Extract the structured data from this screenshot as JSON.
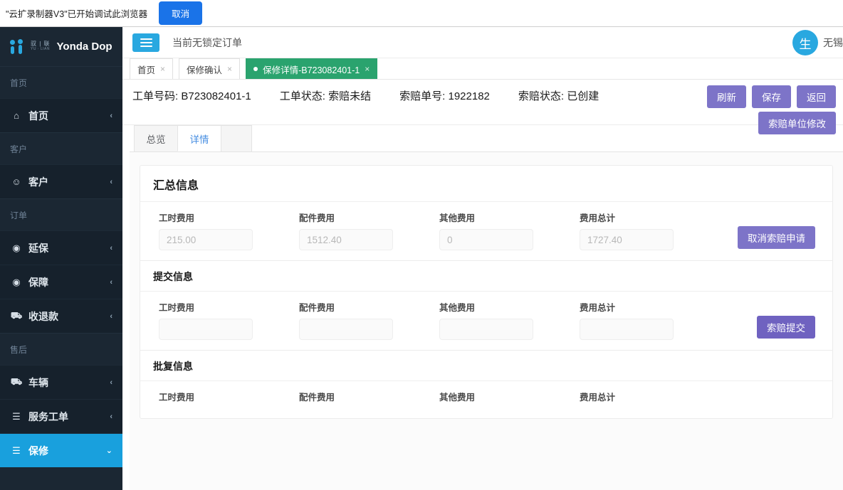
{
  "debug_bar": {
    "message": "\"云扩录制器V3\"已开始调试此浏览器",
    "cancel_label": "取消"
  },
  "sidebar": {
    "brand": {
      "logo_cn_top": "驭 | 联",
      "logo_cn_sub": "YU · LIAN",
      "name": "Yonda Dop"
    },
    "groups": [
      {
        "header": "首页",
        "items": [
          {
            "icon": "home-icon",
            "glyph": "⌂",
            "label": "首页",
            "arrow": "‹",
            "active": false
          }
        ]
      },
      {
        "header": "客户",
        "items": [
          {
            "icon": "user-icon",
            "glyph": "☺",
            "label": "客户",
            "arrow": "‹",
            "active": false
          }
        ]
      },
      {
        "header": "订单",
        "items": [
          {
            "icon": "shield-icon",
            "glyph": "◉",
            "label": "延保",
            "arrow": "‹",
            "active": false
          },
          {
            "icon": "shield-icon",
            "glyph": "◉",
            "label": "保障",
            "arrow": "‹",
            "active": false
          },
          {
            "icon": "car-icon",
            "glyph": "⛟",
            "label": "收退款",
            "arrow": "‹",
            "active": false
          }
        ]
      },
      {
        "header": "售后",
        "items": [
          {
            "icon": "car-icon",
            "glyph": "⛟",
            "label": "车辆",
            "arrow": "‹",
            "active": false
          },
          {
            "icon": "clipboard-icon",
            "glyph": "☰",
            "label": "服务工单",
            "arrow": "‹",
            "active": false
          },
          {
            "icon": "clipboard-icon",
            "glyph": "☰",
            "label": "保修",
            "arrow": "⌄",
            "active": true
          }
        ]
      }
    ]
  },
  "topbar": {
    "menu_toggle": "hamburger-icon",
    "lock_status": "当前无锁定订单",
    "avatar_initial": "生",
    "user_name": "无锡"
  },
  "doc_tabs": [
    {
      "label": "首页",
      "close": "×",
      "active": false
    },
    {
      "label": "保修确认",
      "close": "×",
      "active": false
    },
    {
      "label": "保修详情-B723082401-1",
      "close": "×",
      "active": true
    }
  ],
  "infobar": {
    "fields": [
      {
        "label": "工单号码:",
        "value": "B723082401-1"
      },
      {
        "label": "工单状态:",
        "value": "索赔未结"
      },
      {
        "label": "索赔单号:",
        "value": "1922182"
      },
      {
        "label": "索赔状态:",
        "value": "已创建"
      }
    ],
    "buttons_row1": [
      {
        "label": "刷新",
        "style": "muted"
      },
      {
        "label": "保存",
        "style": "muted"
      },
      {
        "label": "返回",
        "style": "muted"
      }
    ],
    "buttons_row2": [
      {
        "label": "索赔单位修改",
        "style": "muted"
      }
    ]
  },
  "sub_tabs": [
    {
      "label": "总览",
      "active": false
    },
    {
      "label": "详情",
      "active": true
    }
  ],
  "main": {
    "summary_panel": {
      "title": "汇总信息",
      "fields": [
        {
          "label": "工时费用",
          "value": "215.00",
          "placeholder": ""
        },
        {
          "label": "配件费用",
          "value": "1512.40",
          "placeholder": ""
        },
        {
          "label": "其他费用",
          "value": "0",
          "placeholder": ""
        },
        {
          "label": "费用总计",
          "value": "1727.40",
          "placeholder": ""
        }
      ],
      "action": {
        "label": "取消索赔申请",
        "style": "muted"
      }
    },
    "submit_panel": {
      "title": "提交信息",
      "fields": [
        {
          "label": "工时费用",
          "value": "",
          "placeholder": ""
        },
        {
          "label": "配件费用",
          "value": "",
          "placeholder": ""
        },
        {
          "label": "其他费用",
          "value": "",
          "placeholder": ""
        },
        {
          "label": "费用总计",
          "value": "",
          "placeholder": ""
        }
      ],
      "action": {
        "label": "索赔提交",
        "style": "solid"
      }
    },
    "approval_panel": {
      "title": "批复信息",
      "fields": [
        {
          "label": "工时费用",
          "value": "",
          "placeholder": ""
        },
        {
          "label": "配件费用",
          "value": "",
          "placeholder": ""
        },
        {
          "label": "其他费用",
          "value": "",
          "placeholder": ""
        },
        {
          "label": "费用总计",
          "value": "",
          "placeholder": ""
        }
      ]
    }
  },
  "colors": {
    "sidebar_bg": "#1b2733",
    "sidebar_item_bg": "#16212c",
    "accent_blue": "#29a8e0",
    "active_tab_green": "#2aa36e",
    "button_purple": "#6f62c0",
    "button_purple_muted": "#7d74c8",
    "debug_blue": "#1a73e8"
  }
}
